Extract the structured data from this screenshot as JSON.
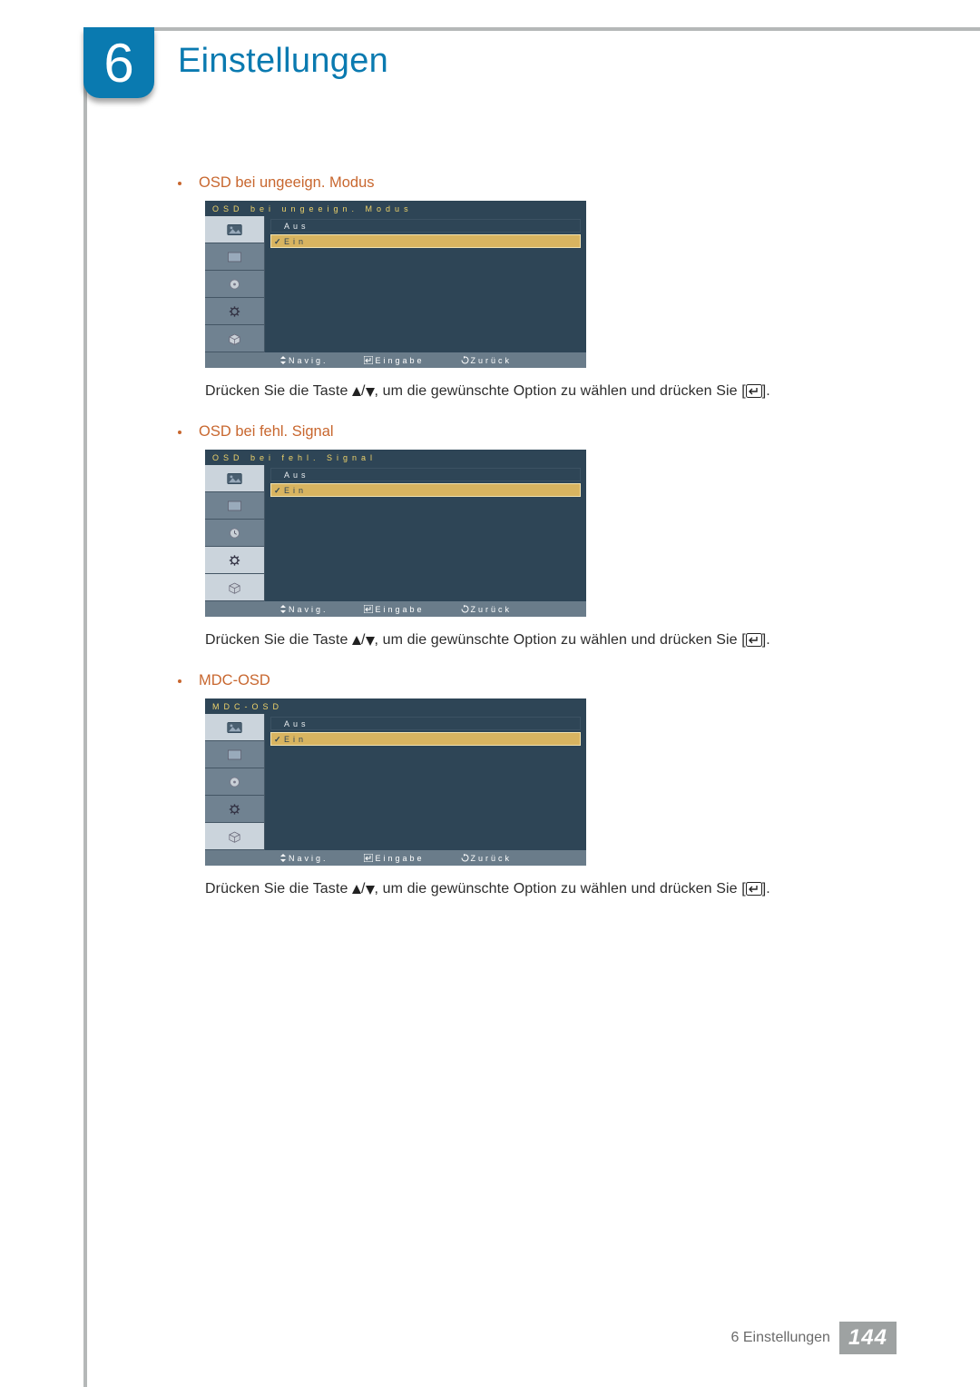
{
  "chapter_number": "6",
  "page_title": "Einstellungen",
  "sections": [
    {
      "heading": "OSD bei ungeeign. Modus",
      "menu_title": "OSD bei ungeeign. Modus",
      "options": {
        "off": "Aus",
        "on": "Ein"
      },
      "footer": {
        "nav": "Navig.",
        "enter": "Eingabe",
        "back": "Zurück"
      },
      "instruction_pre": "Drücken Sie die Taste ",
      "instruction_post": ", um die gewünschte Option zu wählen und drücken Sie ["
    },
    {
      "heading": "OSD bei fehl. Signal",
      "menu_title": "OSD bei fehl. Signal",
      "options": {
        "off": "Aus",
        "on": "Ein"
      },
      "footer": {
        "nav": "Navig.",
        "enter": "Eingabe",
        "back": "Zurück"
      },
      "instruction_pre": "Drücken Sie die Taste ",
      "instruction_post": ", um die gewünschte Option zu wählen und drücken Sie ["
    },
    {
      "heading": "MDC-OSD",
      "menu_title": "MDC-OSD",
      "options": {
        "off": "Aus",
        "on": "Ein"
      },
      "footer": {
        "nav": "Navig.",
        "enter": "Eingabe",
        "back": "Zurück"
      },
      "instruction_pre": "Drücken Sie die Taste ",
      "instruction_post": ", um die gewünschte Option zu wählen und drücken Sie ["
    }
  ],
  "instruction_end": "].",
  "footer_text": "6 Einstellungen",
  "page_number": "144"
}
